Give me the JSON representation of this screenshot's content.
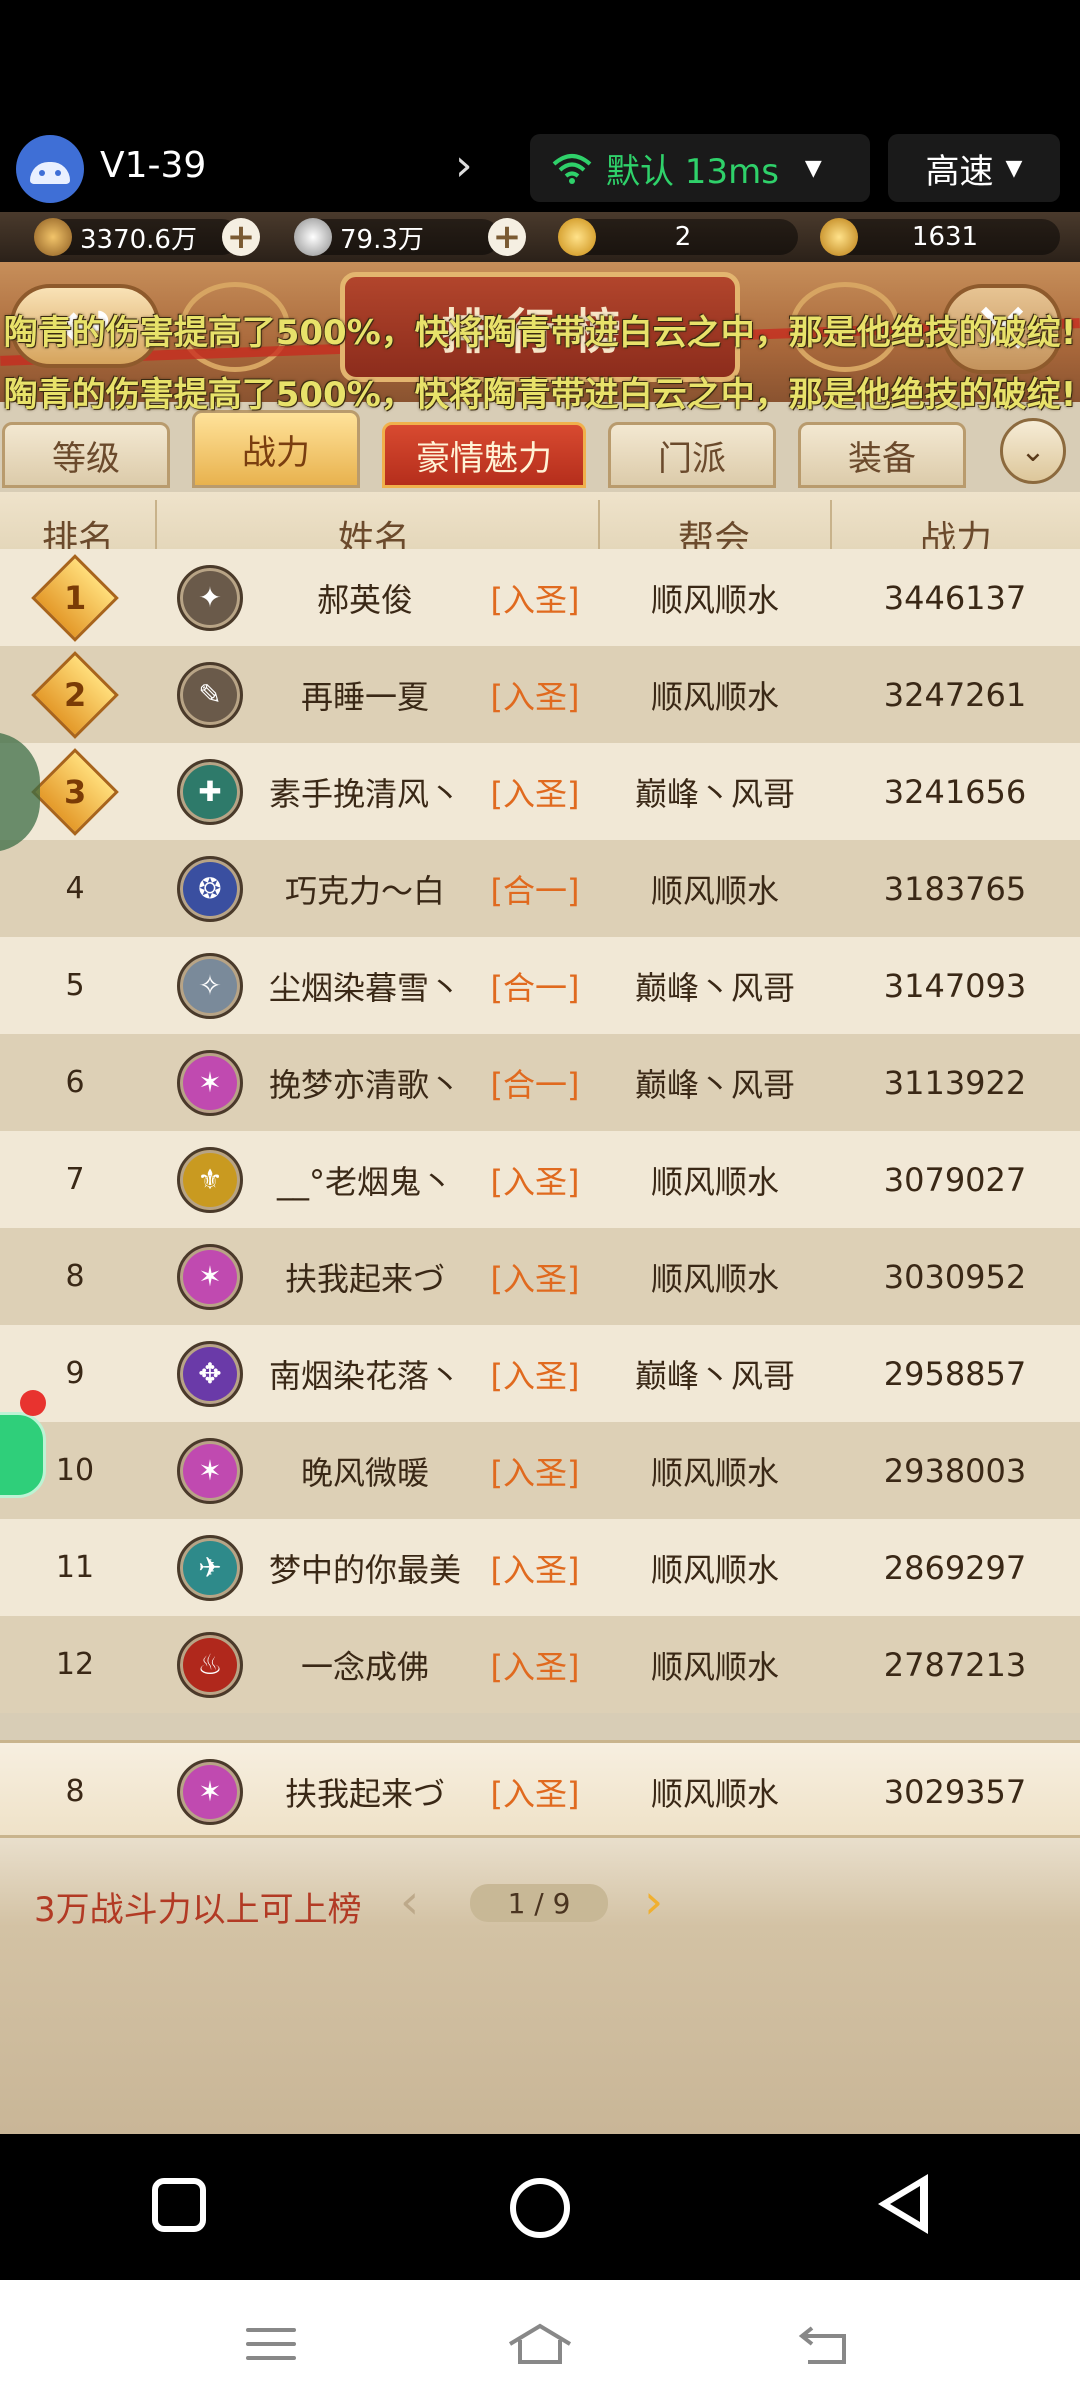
{
  "topbar": {
    "device_name": "V1-39",
    "network_label": "默认 13ms",
    "speed_label": "高速"
  },
  "currency": {
    "copper": "3370.6万",
    "silver": "79.3万",
    "gold": "2",
    "bound_gold": "1631"
  },
  "header": {
    "title": "排行榜"
  },
  "tabs": [
    {
      "label": "等级"
    },
    {
      "label": "战力"
    },
    {
      "label": "豪情魅力"
    },
    {
      "label": "门派"
    },
    {
      "label": "装备"
    }
  ],
  "columns": {
    "rank": "排名",
    "name": "姓名",
    "guild": "帮会",
    "power": "战力"
  },
  "notice_text": "陶青的伤害提高了500%，快将陶青带进白云之中，那是他绝技的破绽!",
  "rows": [
    {
      "rank": "1",
      "name": "郝英俊",
      "realm": "[入圣]",
      "guild": "顺风顺水",
      "power": "3446137",
      "avatar_color": "#6a5a4a"
    },
    {
      "rank": "2",
      "name": "再睡一夏",
      "realm": "[入圣]",
      "guild": "顺风顺水",
      "power": "3247261",
      "avatar_color": "#6a5a4a"
    },
    {
      "rank": "3",
      "name": "素手挽清风丶",
      "realm": "[入圣]",
      "guild": "巅峰丶风哥",
      "power": "3241656",
      "avatar_color": "#2e7a6a"
    },
    {
      "rank": "4",
      "name": "巧克力～白",
      "realm": "[合一]",
      "guild": "顺风顺水",
      "power": "3183765",
      "avatar_color": "#3a4fa0"
    },
    {
      "rank": "5",
      "name": "尘烟染暮雪丶",
      "realm": "[合一]",
      "guild": "巅峰丶风哥",
      "power": "3147093",
      "avatar_color": "#7a8a9a"
    },
    {
      "rank": "6",
      "name": "挽梦亦清歌丶",
      "realm": "[合一]",
      "guild": "巅峰丶风哥",
      "power": "3113922",
      "avatar_color": "#c04ab0"
    },
    {
      "rank": "7",
      "name": "__°老烟鬼丶",
      "realm": "[入圣]",
      "guild": "顺风顺水",
      "power": "3079027",
      "avatar_color": "#c99a20"
    },
    {
      "rank": "8",
      "name": "扶我起来づ",
      "realm": "[入圣]",
      "guild": "顺风顺水",
      "power": "3030952",
      "avatar_color": "#c04ab0"
    },
    {
      "rank": "9",
      "name": "南烟染花落丶",
      "realm": "[入圣]",
      "guild": "巅峰丶风哥",
      "power": "2958857",
      "avatar_color": "#6a3aa8"
    },
    {
      "rank": "10",
      "name": "晚风微暖",
      "realm": "[入圣]",
      "guild": "顺风顺水",
      "power": "2938003",
      "avatar_color": "#c04ab0"
    },
    {
      "rank": "11",
      "name": "梦中的你最美",
      "realm": "[入圣]",
      "guild": "顺风顺水",
      "power": "2869297",
      "avatar_color": "#2e8a8a"
    },
    {
      "rank": "12",
      "name": "一念成佛",
      "realm": "[入圣]",
      "guild": "顺风顺水",
      "power": "2787213",
      "avatar_color": "#b0281c"
    }
  ],
  "my_row": {
    "rank": "8",
    "name": "扶我起来づ",
    "realm": "[入圣]",
    "guild": "顺风顺水",
    "power": "3029357",
    "avatar_color": "#c04ab0"
  },
  "footer": {
    "requirement": "3万战斗力以上可上榜",
    "page_indicator": "1 / 9"
  },
  "colors": {
    "realm": "#e06a1f",
    "notice": "#e8e26a",
    "accent_red": "#b23a24"
  }
}
